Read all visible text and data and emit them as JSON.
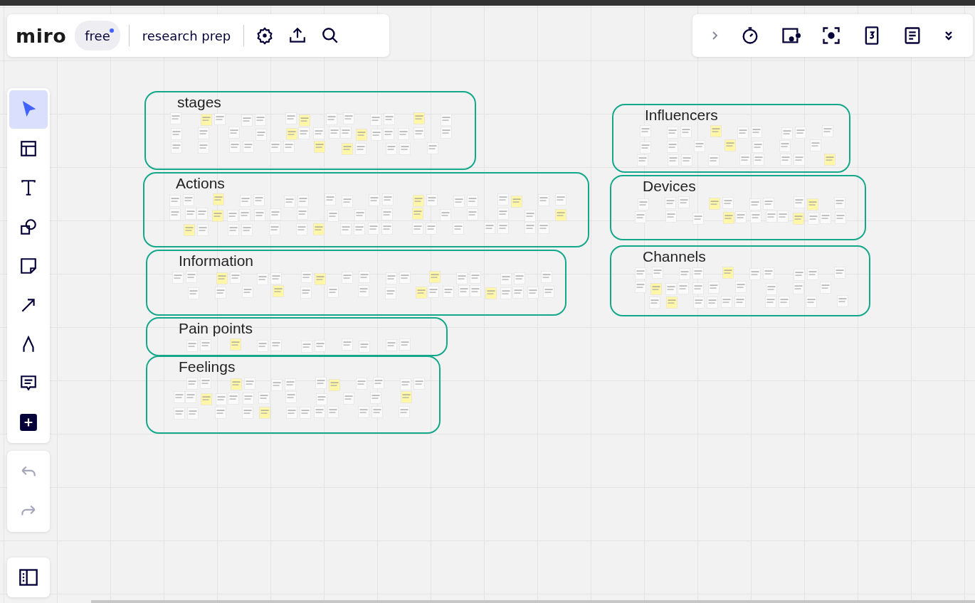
{
  "header": {
    "logo": "miro",
    "plan": {
      "label": "free",
      "notification": true
    },
    "board_name": "research prep"
  },
  "tools": [
    {
      "kind": "select",
      "selected": true
    },
    {
      "kind": "templates",
      "selected": false
    },
    {
      "kind": "text",
      "selected": false
    },
    {
      "kind": "shapes",
      "selected": false
    },
    {
      "kind": "sticky",
      "selected": false
    },
    {
      "kind": "arrow",
      "selected": false
    },
    {
      "kind": "pen",
      "selected": false
    },
    {
      "kind": "comment",
      "selected": false
    },
    {
      "kind": "add",
      "selected": false
    }
  ],
  "frames": [
    {
      "title": "stages"
    },
    {
      "title": "Actions"
    },
    {
      "title": "Information"
    },
    {
      "title": "Pain points"
    },
    {
      "title": "Feelings"
    },
    {
      "title": "Influencers"
    },
    {
      "title": "Devices"
    },
    {
      "title": "Channels"
    }
  ]
}
